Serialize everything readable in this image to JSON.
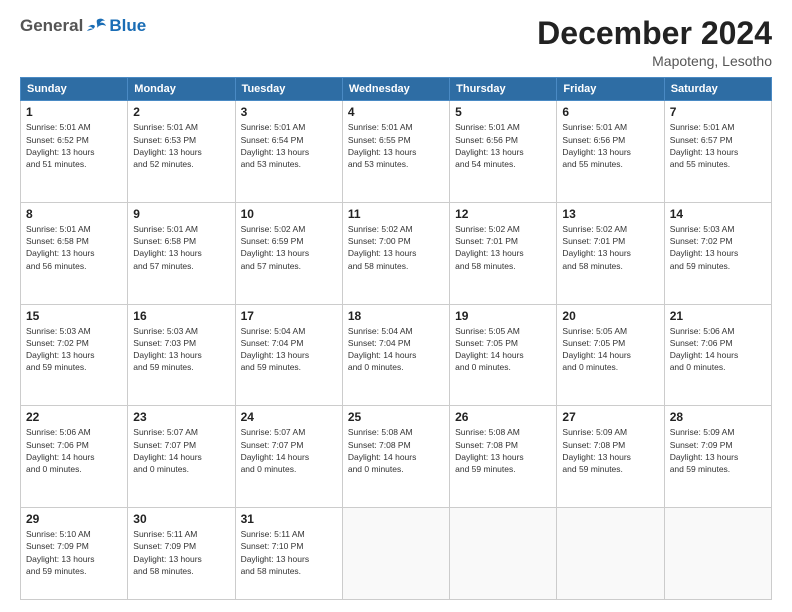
{
  "header": {
    "logo_general": "General",
    "logo_blue": "Blue",
    "month": "December 2024",
    "location": "Mapoteng, Lesotho"
  },
  "weekdays": [
    "Sunday",
    "Monday",
    "Tuesday",
    "Wednesday",
    "Thursday",
    "Friday",
    "Saturday"
  ],
  "weeks": [
    [
      {
        "day": "1",
        "detail": "Sunrise: 5:01 AM\nSunset: 6:52 PM\nDaylight: 13 hours\nand 51 minutes."
      },
      {
        "day": "2",
        "detail": "Sunrise: 5:01 AM\nSunset: 6:53 PM\nDaylight: 13 hours\nand 52 minutes."
      },
      {
        "day": "3",
        "detail": "Sunrise: 5:01 AM\nSunset: 6:54 PM\nDaylight: 13 hours\nand 53 minutes."
      },
      {
        "day": "4",
        "detail": "Sunrise: 5:01 AM\nSunset: 6:55 PM\nDaylight: 13 hours\nand 53 minutes."
      },
      {
        "day": "5",
        "detail": "Sunrise: 5:01 AM\nSunset: 6:56 PM\nDaylight: 13 hours\nand 54 minutes."
      },
      {
        "day": "6",
        "detail": "Sunrise: 5:01 AM\nSunset: 6:56 PM\nDaylight: 13 hours\nand 55 minutes."
      },
      {
        "day": "7",
        "detail": "Sunrise: 5:01 AM\nSunset: 6:57 PM\nDaylight: 13 hours\nand 55 minutes."
      }
    ],
    [
      {
        "day": "8",
        "detail": "Sunrise: 5:01 AM\nSunset: 6:58 PM\nDaylight: 13 hours\nand 56 minutes."
      },
      {
        "day": "9",
        "detail": "Sunrise: 5:01 AM\nSunset: 6:58 PM\nDaylight: 13 hours\nand 57 minutes."
      },
      {
        "day": "10",
        "detail": "Sunrise: 5:02 AM\nSunset: 6:59 PM\nDaylight: 13 hours\nand 57 minutes."
      },
      {
        "day": "11",
        "detail": "Sunrise: 5:02 AM\nSunset: 7:00 PM\nDaylight: 13 hours\nand 58 minutes."
      },
      {
        "day": "12",
        "detail": "Sunrise: 5:02 AM\nSunset: 7:01 PM\nDaylight: 13 hours\nand 58 minutes."
      },
      {
        "day": "13",
        "detail": "Sunrise: 5:02 AM\nSunset: 7:01 PM\nDaylight: 13 hours\nand 58 minutes."
      },
      {
        "day": "14",
        "detail": "Sunrise: 5:03 AM\nSunset: 7:02 PM\nDaylight: 13 hours\nand 59 minutes."
      }
    ],
    [
      {
        "day": "15",
        "detail": "Sunrise: 5:03 AM\nSunset: 7:02 PM\nDaylight: 13 hours\nand 59 minutes."
      },
      {
        "day": "16",
        "detail": "Sunrise: 5:03 AM\nSunset: 7:03 PM\nDaylight: 13 hours\nand 59 minutes."
      },
      {
        "day": "17",
        "detail": "Sunrise: 5:04 AM\nSunset: 7:04 PM\nDaylight: 13 hours\nand 59 minutes."
      },
      {
        "day": "18",
        "detail": "Sunrise: 5:04 AM\nSunset: 7:04 PM\nDaylight: 14 hours\nand 0 minutes."
      },
      {
        "day": "19",
        "detail": "Sunrise: 5:05 AM\nSunset: 7:05 PM\nDaylight: 14 hours\nand 0 minutes."
      },
      {
        "day": "20",
        "detail": "Sunrise: 5:05 AM\nSunset: 7:05 PM\nDaylight: 14 hours\nand 0 minutes."
      },
      {
        "day": "21",
        "detail": "Sunrise: 5:06 AM\nSunset: 7:06 PM\nDaylight: 14 hours\nand 0 minutes."
      }
    ],
    [
      {
        "day": "22",
        "detail": "Sunrise: 5:06 AM\nSunset: 7:06 PM\nDaylight: 14 hours\nand 0 minutes."
      },
      {
        "day": "23",
        "detail": "Sunrise: 5:07 AM\nSunset: 7:07 PM\nDaylight: 14 hours\nand 0 minutes."
      },
      {
        "day": "24",
        "detail": "Sunrise: 5:07 AM\nSunset: 7:07 PM\nDaylight: 14 hours\nand 0 minutes."
      },
      {
        "day": "25",
        "detail": "Sunrise: 5:08 AM\nSunset: 7:08 PM\nDaylight: 14 hours\nand 0 minutes."
      },
      {
        "day": "26",
        "detail": "Sunrise: 5:08 AM\nSunset: 7:08 PM\nDaylight: 13 hours\nand 59 minutes."
      },
      {
        "day": "27",
        "detail": "Sunrise: 5:09 AM\nSunset: 7:08 PM\nDaylight: 13 hours\nand 59 minutes."
      },
      {
        "day": "28",
        "detail": "Sunrise: 5:09 AM\nSunset: 7:09 PM\nDaylight: 13 hours\nand 59 minutes."
      }
    ],
    [
      {
        "day": "29",
        "detail": "Sunrise: 5:10 AM\nSunset: 7:09 PM\nDaylight: 13 hours\nand 59 minutes."
      },
      {
        "day": "30",
        "detail": "Sunrise: 5:11 AM\nSunset: 7:09 PM\nDaylight: 13 hours\nand 58 minutes."
      },
      {
        "day": "31",
        "detail": "Sunrise: 5:11 AM\nSunset: 7:10 PM\nDaylight: 13 hours\nand 58 minutes."
      },
      null,
      null,
      null,
      null
    ]
  ]
}
